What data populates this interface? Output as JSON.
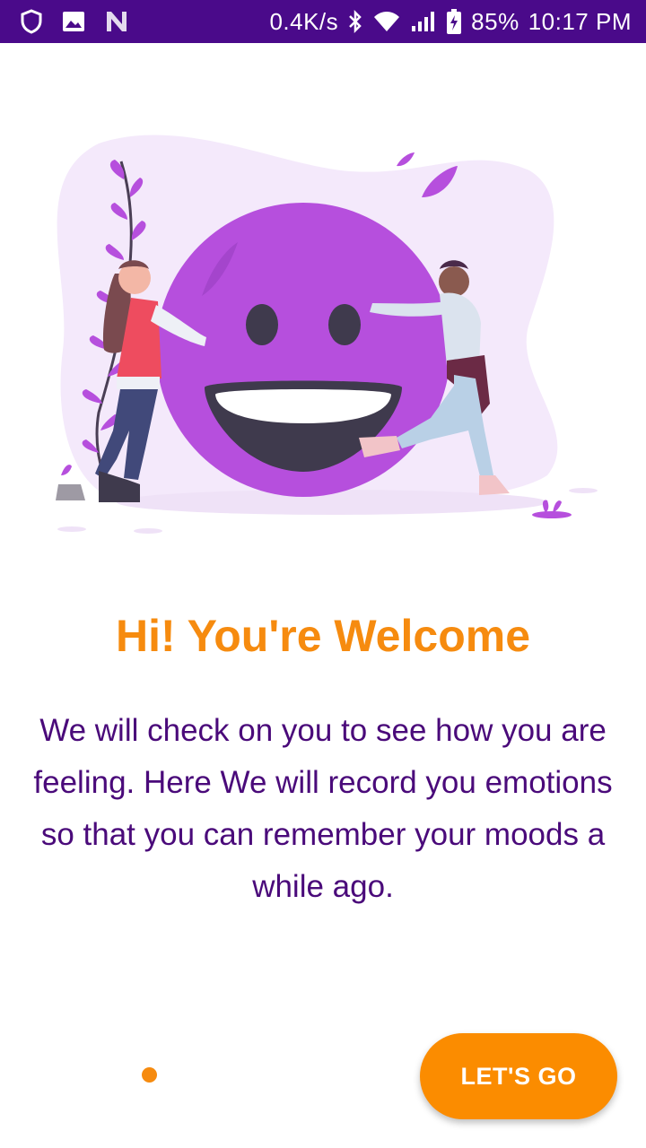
{
  "status_bar": {
    "net_speed": "0.4K/s",
    "battery_percent": "85%",
    "time": "10:17 PM",
    "icons": [
      "shield-icon",
      "image-icon",
      "n-logo-icon",
      "bluetooth-icon",
      "wifi-icon",
      "signal-icon",
      "battery-icon"
    ],
    "background": "#4a0a8a"
  },
  "onboarding": {
    "illustration": "smiley-hug-illustration",
    "title": "Hi! You're Welcome",
    "description": "We will check on you to see how you are feeling. Here We will record you emotions so that you can remember your moods a while ago.",
    "pager": {
      "current": 1
    },
    "cta_label": "LET'S GO"
  },
  "colors": {
    "accent": "#f68b0f",
    "button": "#fb8c00",
    "text_primary": "#4a0a7a",
    "smiley": "#b64fdd"
  }
}
